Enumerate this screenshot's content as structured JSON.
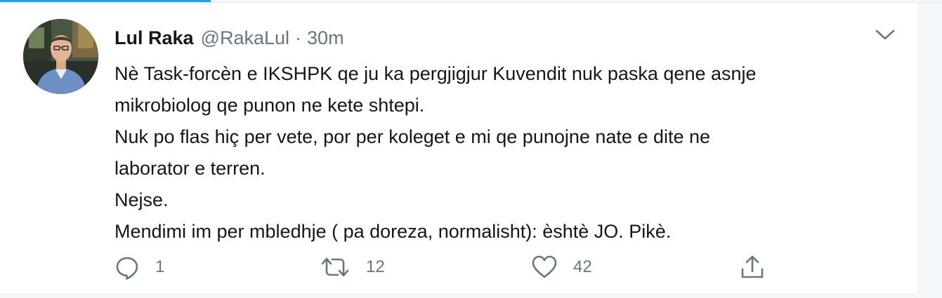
{
  "tweet": {
    "author_name": "Lul Raka",
    "handle": "@RakaLul",
    "separator": "·",
    "time": "30m",
    "lines": [
      "Nè Task-forcèn e IKSHPK qe ju ka pergjigjur Kuvendit nuk paska qene asnje",
      "mikrobiolog qe punon ne kete shtepi.",
      "Nuk po flas hiç per vete, por per koleget e mi qe punojne nate e dite ne",
      "laborator e terren.",
      "Nejse.",
      "Mendimi im per mbledhje ( pa doreza, normalisht): èshtè JO. Pikè."
    ]
  },
  "actions": {
    "reply": {
      "icon": "reply-icon",
      "count": "1"
    },
    "retweet": {
      "icon": "retweet-icon",
      "count": "12"
    },
    "like": {
      "icon": "heart-icon",
      "count": "42"
    },
    "share": {
      "icon": "share-icon"
    }
  },
  "colors": {
    "accent": "#1da1f2",
    "text": "#14171a",
    "secondary": "#657786",
    "border": "#e6ecf0"
  }
}
